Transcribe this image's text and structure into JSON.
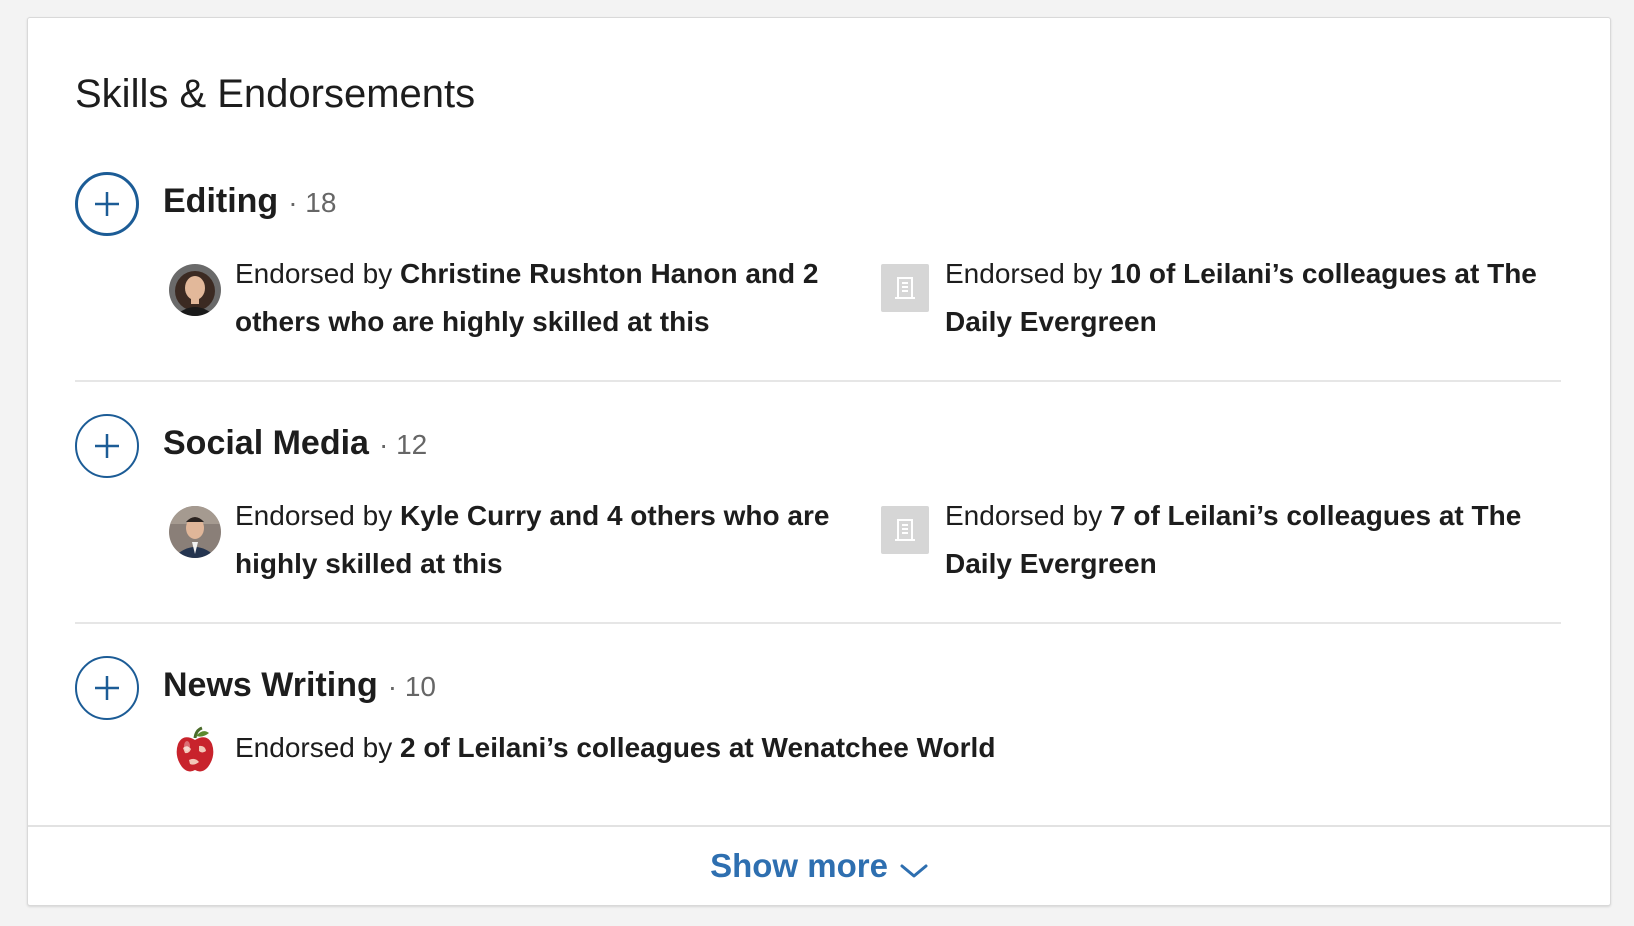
{
  "section": {
    "title": "Skills & Endorsements"
  },
  "endorsed_by_prefix": "Endorsed by",
  "skills": [
    {
      "name": "Editing",
      "count": "· 18",
      "endorsements": [
        {
          "icon": "person-avatar",
          "who": "Christine Rushton Hanon and 2 others who are highly skilled at this"
        },
        {
          "icon": "company-building-icon",
          "who": "10 of Leilani’s colleagues at The Daily Evergreen"
        }
      ]
    },
    {
      "name": "Social Media",
      "count": "· 12",
      "endorsements": [
        {
          "icon": "person-avatar",
          "who": "Kyle Curry and 4 others who are highly skilled at this"
        },
        {
          "icon": "company-building-icon",
          "who": "7 of Leilani’s colleagues at The Daily Evergreen"
        }
      ]
    },
    {
      "name": "News Writing",
      "count": "· 10",
      "endorsements": [
        {
          "icon": "apple-globe-logo",
          "who": "2 of Leilani’s colleagues at Wenatchee World"
        }
      ]
    }
  ],
  "footer": {
    "show_more_label": "Show more"
  },
  "colors": {
    "accent": "#1c5c96",
    "link": "#2e6fb0",
    "divider": "#e6e6e6",
    "logo_placeholder": "#d6d6d6"
  }
}
